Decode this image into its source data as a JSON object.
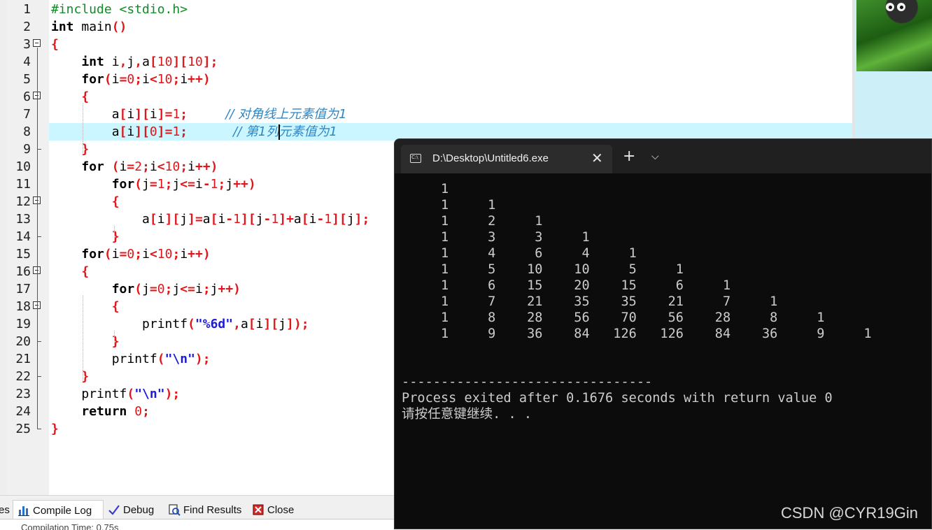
{
  "editor": {
    "code_lines": [
      {
        "n": "1",
        "fold": "",
        "html": "<span class=\"pp\">#include &lt;stdio.h&gt;</span>"
      },
      {
        "n": "2",
        "fold": "",
        "html": "<span class=\"kw\">int</span> main<span class=\"op\">()</span>"
      },
      {
        "n": "3",
        "fold": "open",
        "html": "<span class=\"op\">{</span>"
      },
      {
        "n": "4",
        "fold": "",
        "html": "    <span class=\"kw\">int</span> i<span class=\"op\">,</span>j<span class=\"op\">,</span>a<span class=\"op\">[</span><span class=\"num\">10</span><span class=\"op\">][</span><span class=\"num\">10</span><span class=\"op\">];</span>"
      },
      {
        "n": "5",
        "fold": "",
        "html": "    <span class=\"kw\">for</span><span class=\"op\">(</span>i<span class=\"op\">=</span><span class=\"num\">0</span><span class=\"op\">;</span>i<span class=\"op\">&lt;</span><span class=\"num\">10</span><span class=\"op\">;</span>i<span class=\"op\">++)</span>"
      },
      {
        "n": "6",
        "fold": "open",
        "html": "    <span class=\"op\">{</span>"
      },
      {
        "n": "7",
        "fold": "",
        "html": "        a<span class=\"op\">[</span>i<span class=\"op\">][</span>i<span class=\"op\">]=</span><span class=\"num\">1</span><span class=\"op\">;</span>     <span class=\"cmt\">// 对角线上元素值为1</span>"
      },
      {
        "n": "8",
        "fold": "",
        "html": "        a<span class=\"op\">[</span>i<span class=\"op\">][</span><span class=\"num\">0</span><span class=\"op\">]=</span><span class=\"num\">1</span><span class=\"op\">;</span>      <span class=\"cmt\">// 第1列元素值为1</span>"
      },
      {
        "n": "9",
        "fold": "end",
        "html": "    <span class=\"op\">}</span>"
      },
      {
        "n": "10",
        "fold": "",
        "html": "    <span class=\"kw\">for</span> <span class=\"op\">(</span>i<span class=\"op\">=</span><span class=\"num\">2</span><span class=\"op\">;</span>i<span class=\"op\">&lt;</span><span class=\"num\">10</span><span class=\"op\">;</span>i<span class=\"op\">++)</span>"
      },
      {
        "n": "11",
        "fold": "",
        "html": "        <span class=\"kw\">for</span><span class=\"op\">(</span>j<span class=\"op\">=</span><span class=\"num\">1</span><span class=\"op\">;</span>j<span class=\"op\">&lt;=</span>i<span class=\"op\">-</span><span class=\"num\">1</span><span class=\"op\">;</span>j<span class=\"op\">++)</span>"
      },
      {
        "n": "12",
        "fold": "open",
        "html": "        <span class=\"op\">{</span>"
      },
      {
        "n": "13",
        "fold": "",
        "html": "            a<span class=\"op\">[</span>i<span class=\"op\">][</span>j<span class=\"op\">]=</span>a<span class=\"op\">[</span>i<span class=\"op\">-</span><span class=\"num\">1</span><span class=\"op\">][</span>j<span class=\"op\">-</span><span class=\"num\">1</span><span class=\"op\">]+</span>a<span class=\"op\">[</span>i<span class=\"op\">-</span><span class=\"num\">1</span><span class=\"op\">][</span>j<span class=\"op\">];</span>"
      },
      {
        "n": "14",
        "fold": "end",
        "html": "        <span class=\"op\">}</span>"
      },
      {
        "n": "15",
        "fold": "",
        "html": "    <span class=\"kw\">for</span><span class=\"op\">(</span>i<span class=\"op\">=</span><span class=\"num\">0</span><span class=\"op\">;</span>i<span class=\"op\">&lt;</span><span class=\"num\">10</span><span class=\"op\">;</span>i<span class=\"op\">++)</span>"
      },
      {
        "n": "16",
        "fold": "open",
        "html": "    <span class=\"op\">{</span>"
      },
      {
        "n": "17",
        "fold": "",
        "html": "        <span class=\"kw\">for</span><span class=\"op\">(</span>j<span class=\"op\">=</span><span class=\"num\">0</span><span class=\"op\">;</span>j<span class=\"op\">&lt;=</span>i<span class=\"op\">;</span>j<span class=\"op\">++)</span>"
      },
      {
        "n": "18",
        "fold": "open",
        "html": "        <span class=\"op\">{</span>"
      },
      {
        "n": "19",
        "fold": "",
        "html": "            printf<span class=\"op\">(</span><span class=\"str\">\"%6d\"</span><span class=\"op\">,</span>a<span class=\"op\">[</span>i<span class=\"op\">][</span>j<span class=\"op\">]);</span>"
      },
      {
        "n": "20",
        "fold": "end",
        "html": "        <span class=\"op\">}</span>"
      },
      {
        "n": "21",
        "fold": "",
        "html": "        printf<span class=\"op\">(</span><span class=\"str\">\"\\n\"</span><span class=\"op\">);</span>"
      },
      {
        "n": "22",
        "fold": "end",
        "html": "    <span class=\"op\">}</span>"
      },
      {
        "n": "23",
        "fold": "",
        "html": "    printf<span class=\"op\">(</span><span class=\"str\">\"\\n\"</span><span class=\"op\">);</span>"
      },
      {
        "n": "24",
        "fold": "",
        "html": "    <span class=\"kw\">return</span> <span class=\"num\">0</span><span class=\"op\">;</span>"
      },
      {
        "n": "25",
        "fold": "end",
        "html": "<span class=\"op\">}</span>"
      }
    ],
    "highlighted_line": "8"
  },
  "bottom_tabs": [
    {
      "label": "es",
      "icon": ""
    },
    {
      "label": "Compile Log",
      "icon": "bar-chart-icon"
    },
    {
      "label": "Debug",
      "icon": "check-icon"
    },
    {
      "label": "Find Results",
      "icon": "find-icon"
    },
    {
      "label": "Close",
      "icon": "close-icon"
    }
  ],
  "log_text": "Compilation Time: 0.75s",
  "console": {
    "title": "D:\\Desktop\\Untitled6.exe",
    "close_glyph": "✕",
    "new_tab_glyph": "+",
    "dropdown_glyph": "⌵",
    "rows": [
      [
        "1"
      ],
      [
        "1",
        "1"
      ],
      [
        "1",
        "2",
        "1"
      ],
      [
        "1",
        "3",
        "3",
        "1"
      ],
      [
        "1",
        "4",
        "6",
        "4",
        "1"
      ],
      [
        "1",
        "5",
        "10",
        "10",
        "5",
        "1"
      ],
      [
        "1",
        "6",
        "15",
        "20",
        "15",
        "6",
        "1"
      ],
      [
        "1",
        "7",
        "21",
        "35",
        "35",
        "21",
        "7",
        "1"
      ],
      [
        "1",
        "8",
        "28",
        "56",
        "70",
        "56",
        "28",
        "8",
        "1"
      ],
      [
        "1",
        "9",
        "36",
        "84",
        "126",
        "126",
        "84",
        "36",
        "9",
        "1"
      ]
    ],
    "separator": "--------------------------------",
    "exit_message": "Process exited after 0.1676 seconds with return value 0",
    "continue_prompt": "请按任意键继续. . ."
  },
  "watermark": "CSDN @CYR19Gin",
  "colors": {
    "highlight_line": "#ccf6ff",
    "console_bg": "#0c0c0c",
    "console_text": "#cccccc",
    "keyword": "#000000",
    "operator": "#e0161b",
    "string": "#1b1bd8",
    "comment": "#2d86c6",
    "preprocessor": "#118a28"
  }
}
